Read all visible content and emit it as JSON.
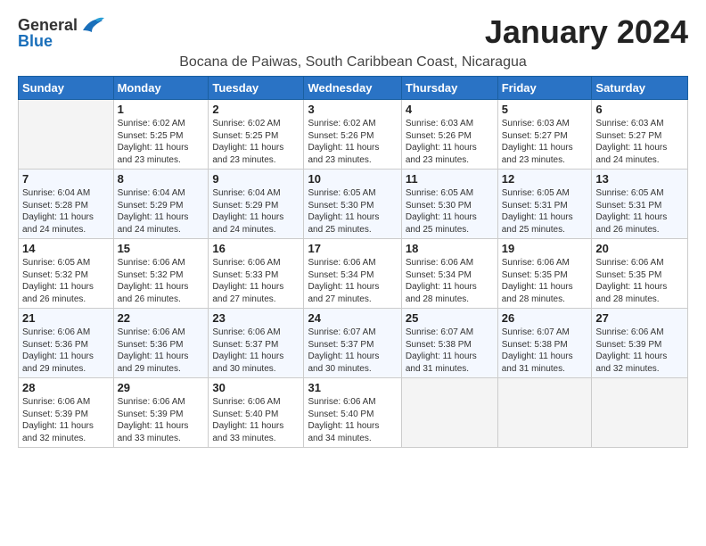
{
  "logo": {
    "general": "General",
    "blue": "Blue"
  },
  "header": {
    "month_year": "January 2024",
    "location": "Bocana de Paiwas, South Caribbean Coast, Nicaragua"
  },
  "days_of_week": [
    "Sunday",
    "Monday",
    "Tuesday",
    "Wednesday",
    "Thursday",
    "Friday",
    "Saturday"
  ],
  "weeks": [
    [
      {
        "day": "",
        "info": ""
      },
      {
        "day": "1",
        "info": "Sunrise: 6:02 AM\nSunset: 5:25 PM\nDaylight: 11 hours\nand 23 minutes."
      },
      {
        "day": "2",
        "info": "Sunrise: 6:02 AM\nSunset: 5:25 PM\nDaylight: 11 hours\nand 23 minutes."
      },
      {
        "day": "3",
        "info": "Sunrise: 6:02 AM\nSunset: 5:26 PM\nDaylight: 11 hours\nand 23 minutes."
      },
      {
        "day": "4",
        "info": "Sunrise: 6:03 AM\nSunset: 5:26 PM\nDaylight: 11 hours\nand 23 minutes."
      },
      {
        "day": "5",
        "info": "Sunrise: 6:03 AM\nSunset: 5:27 PM\nDaylight: 11 hours\nand 23 minutes."
      },
      {
        "day": "6",
        "info": "Sunrise: 6:03 AM\nSunset: 5:27 PM\nDaylight: 11 hours\nand 24 minutes."
      }
    ],
    [
      {
        "day": "7",
        "info": "Sunrise: 6:04 AM\nSunset: 5:28 PM\nDaylight: 11 hours\nand 24 minutes."
      },
      {
        "day": "8",
        "info": "Sunrise: 6:04 AM\nSunset: 5:29 PM\nDaylight: 11 hours\nand 24 minutes."
      },
      {
        "day": "9",
        "info": "Sunrise: 6:04 AM\nSunset: 5:29 PM\nDaylight: 11 hours\nand 24 minutes."
      },
      {
        "day": "10",
        "info": "Sunrise: 6:05 AM\nSunset: 5:30 PM\nDaylight: 11 hours\nand 25 minutes."
      },
      {
        "day": "11",
        "info": "Sunrise: 6:05 AM\nSunset: 5:30 PM\nDaylight: 11 hours\nand 25 minutes."
      },
      {
        "day": "12",
        "info": "Sunrise: 6:05 AM\nSunset: 5:31 PM\nDaylight: 11 hours\nand 25 minutes."
      },
      {
        "day": "13",
        "info": "Sunrise: 6:05 AM\nSunset: 5:31 PM\nDaylight: 11 hours\nand 26 minutes."
      }
    ],
    [
      {
        "day": "14",
        "info": "Sunrise: 6:05 AM\nSunset: 5:32 PM\nDaylight: 11 hours\nand 26 minutes."
      },
      {
        "day": "15",
        "info": "Sunrise: 6:06 AM\nSunset: 5:32 PM\nDaylight: 11 hours\nand 26 minutes."
      },
      {
        "day": "16",
        "info": "Sunrise: 6:06 AM\nSunset: 5:33 PM\nDaylight: 11 hours\nand 27 minutes."
      },
      {
        "day": "17",
        "info": "Sunrise: 6:06 AM\nSunset: 5:34 PM\nDaylight: 11 hours\nand 27 minutes."
      },
      {
        "day": "18",
        "info": "Sunrise: 6:06 AM\nSunset: 5:34 PM\nDaylight: 11 hours\nand 28 minutes."
      },
      {
        "day": "19",
        "info": "Sunrise: 6:06 AM\nSunset: 5:35 PM\nDaylight: 11 hours\nand 28 minutes."
      },
      {
        "day": "20",
        "info": "Sunrise: 6:06 AM\nSunset: 5:35 PM\nDaylight: 11 hours\nand 28 minutes."
      }
    ],
    [
      {
        "day": "21",
        "info": "Sunrise: 6:06 AM\nSunset: 5:36 PM\nDaylight: 11 hours\nand 29 minutes."
      },
      {
        "day": "22",
        "info": "Sunrise: 6:06 AM\nSunset: 5:36 PM\nDaylight: 11 hours\nand 29 minutes."
      },
      {
        "day": "23",
        "info": "Sunrise: 6:06 AM\nSunset: 5:37 PM\nDaylight: 11 hours\nand 30 minutes."
      },
      {
        "day": "24",
        "info": "Sunrise: 6:07 AM\nSunset: 5:37 PM\nDaylight: 11 hours\nand 30 minutes."
      },
      {
        "day": "25",
        "info": "Sunrise: 6:07 AM\nSunset: 5:38 PM\nDaylight: 11 hours\nand 31 minutes."
      },
      {
        "day": "26",
        "info": "Sunrise: 6:07 AM\nSunset: 5:38 PM\nDaylight: 11 hours\nand 31 minutes."
      },
      {
        "day": "27",
        "info": "Sunrise: 6:06 AM\nSunset: 5:39 PM\nDaylight: 11 hours\nand 32 minutes."
      }
    ],
    [
      {
        "day": "28",
        "info": "Sunrise: 6:06 AM\nSunset: 5:39 PM\nDaylight: 11 hours\nand 32 minutes."
      },
      {
        "day": "29",
        "info": "Sunrise: 6:06 AM\nSunset: 5:39 PM\nDaylight: 11 hours\nand 33 minutes."
      },
      {
        "day": "30",
        "info": "Sunrise: 6:06 AM\nSunset: 5:40 PM\nDaylight: 11 hours\nand 33 minutes."
      },
      {
        "day": "31",
        "info": "Sunrise: 6:06 AM\nSunset: 5:40 PM\nDaylight: 11 hours\nand 34 minutes."
      },
      {
        "day": "",
        "info": ""
      },
      {
        "day": "",
        "info": ""
      },
      {
        "day": "",
        "info": ""
      }
    ]
  ]
}
